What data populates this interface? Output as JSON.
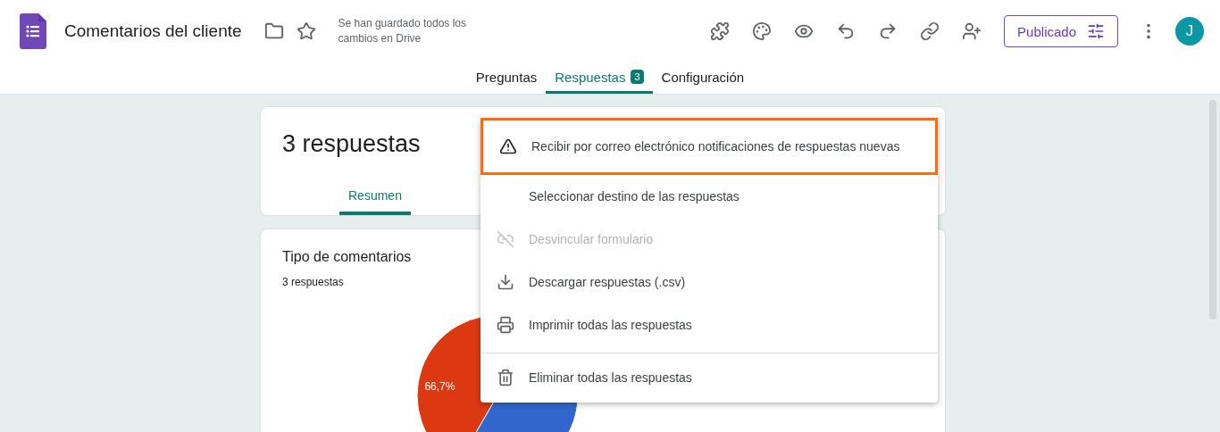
{
  "header": {
    "title": "Comentarios del cliente",
    "save_status": "Se han guardado todos los cambios en Drive",
    "publish_button": "Publicado",
    "avatar": "J"
  },
  "tabs": [
    {
      "label": "Preguntas",
      "selected": false
    },
    {
      "label": "Respuestas",
      "selected": true,
      "badge": "3"
    },
    {
      "label": "Configuración",
      "selected": false
    }
  ],
  "summary_card": {
    "title": "3 respuestas",
    "tabs": [
      {
        "label": "Resumen",
        "selected": true
      }
    ]
  },
  "question_card": {
    "title": "Tipo de comentarios",
    "subtitle": "3 respuestas",
    "chart_data": {
      "type": "pie",
      "values": [
        66.7,
        33.3
      ],
      "data_labels": true,
      "value_labels": [
        "66,7%",
        null
      ]
    }
  },
  "menu": {
    "items": [
      {
        "label": "Recibir por correo electrónico notificaciones de respuestas nuevas",
        "disabled": false,
        "highlighted": true,
        "separated": false
      },
      {
        "label": "Seleccionar destino de las respuestas",
        "disabled": false,
        "highlighted": false,
        "separated": false
      },
      {
        "label": "Desvincular formulario",
        "disabled": true,
        "highlighted": false,
        "separated": false
      },
      {
        "label": "Descargar respuestas (.csv)",
        "disabled": false,
        "highlighted": false,
        "separated": false
      },
      {
        "label": "Imprimir todas las respuestas",
        "disabled": false,
        "highlighted": false,
        "separated": false
      },
      {
        "label": "Eliminar todas las respuestas",
        "disabled": false,
        "highlighted": false,
        "separated": true
      }
    ]
  }
}
